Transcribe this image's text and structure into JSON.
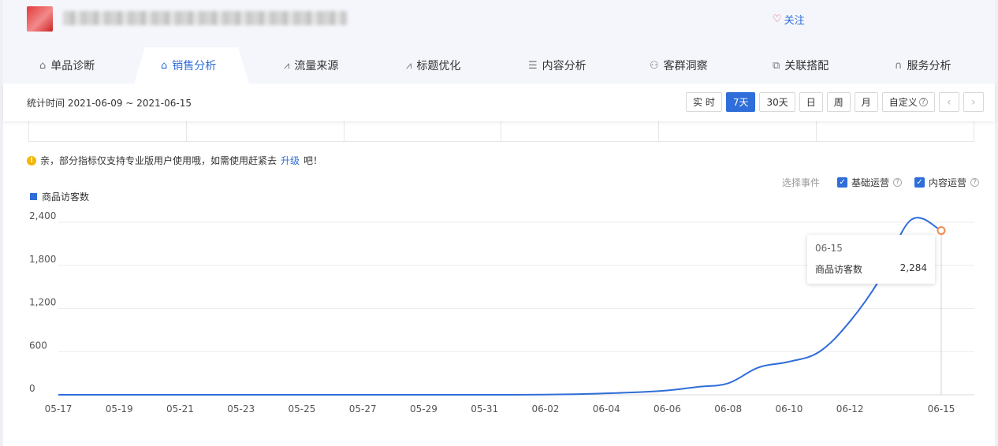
{
  "header": {
    "follow_label": "关注"
  },
  "tabs": [
    {
      "label": "单品诊断",
      "icon": "bag-icon"
    },
    {
      "label": "销售分析",
      "icon": "bag-icon",
      "active": true
    },
    {
      "label": "流量来源",
      "icon": "line-chart-icon"
    },
    {
      "label": "标题优化",
      "icon": "line-chart-icon"
    },
    {
      "label": "内容分析",
      "icon": "document-icon"
    },
    {
      "label": "客群洞察",
      "icon": "users-icon"
    },
    {
      "label": "关联搭配",
      "icon": "link-icon"
    },
    {
      "label": "服务分析",
      "icon": "headset-icon"
    }
  ],
  "toolbar": {
    "period_label": "统计时间 2021-06-09 ~ 2021-06-15",
    "buttons": [
      "实 时",
      "7天",
      "30天",
      "日",
      "周",
      "月",
      "自定义"
    ],
    "active_button": "7天",
    "prev": "‹",
    "next": "›"
  },
  "notice": {
    "text_before": "亲，部分指标仅支持专业版用户使用哦，如需使用赶紧去",
    "link": "升级",
    "text_after": "吧！"
  },
  "events": {
    "label": "选择事件",
    "items": [
      {
        "label": "基础运营",
        "checked": true
      },
      {
        "label": "内容运营",
        "checked": true
      }
    ]
  },
  "colors": {
    "accent": "#2f6dd9",
    "warn": "#f2b705",
    "highlight": "#f08a4b"
  },
  "chart_data": {
    "type": "line",
    "series": [
      {
        "name": "商品访客数",
        "x": [
          "05-17",
          "05-18",
          "05-19",
          "05-20",
          "05-21",
          "05-22",
          "05-23",
          "05-24",
          "05-25",
          "05-26",
          "05-27",
          "05-28",
          "05-29",
          "05-30",
          "05-31",
          "06-01",
          "06-02",
          "06-03",
          "06-04",
          "06-05",
          "06-06",
          "06-07",
          "06-08",
          "06-09",
          "06-10",
          "06-11",
          "06-12",
          "06-13",
          "06-14",
          "06-15"
        ],
        "values": [
          0,
          0,
          0,
          0,
          0,
          0,
          0,
          0,
          0,
          0,
          0,
          0,
          0,
          0,
          0,
          0,
          3,
          8,
          20,
          35,
          60,
          110,
          160,
          380,
          460,
          600,
          1020,
          1620,
          2430,
          2284
        ]
      }
    ],
    "x_ticks": [
      "05-17",
      "05-19",
      "05-21",
      "05-23",
      "05-25",
      "05-27",
      "05-29",
      "05-31",
      "06-02",
      "06-04",
      "06-06",
      "06-08",
      "06-10",
      "06-12",
      "06-15"
    ],
    "y_ticks": [
      "0",
      "600",
      "1,200",
      "1,800",
      "2,400"
    ],
    "ylim": [
      0,
      2400
    ],
    "grid": true,
    "legend_position": "top-left",
    "tooltip": {
      "date": "06-15",
      "label": "商品访客数",
      "value": "2,284"
    }
  }
}
